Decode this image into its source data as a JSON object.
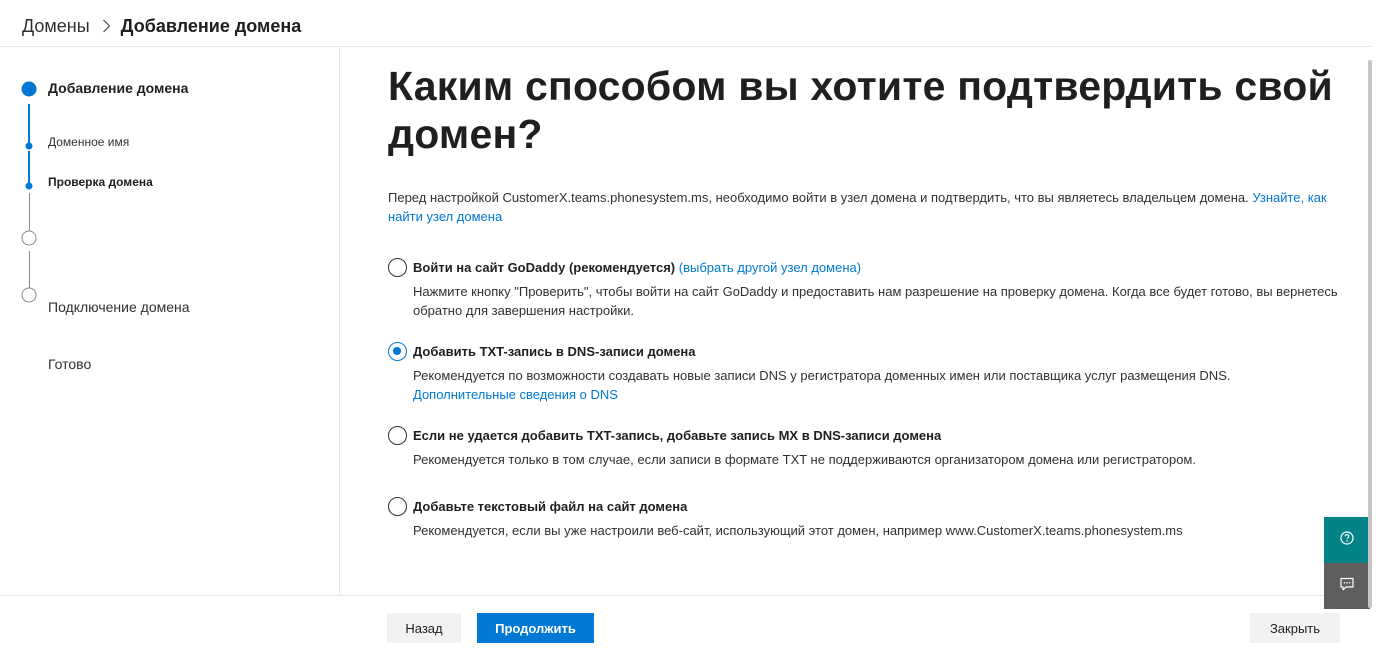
{
  "breadcrumb": {
    "root": "Домены",
    "current": "Добавление домена"
  },
  "stepper": {
    "steps": [
      {
        "label": "Добавление домена",
        "state": "current"
      },
      {
        "label": "Доменное имя",
        "state": "done"
      },
      {
        "label": "Проверка домена",
        "state": "current"
      },
      {
        "label": "Подключение домена",
        "state": "pending"
      },
      {
        "label": "Готово",
        "state": "pending"
      }
    ]
  },
  "main": {
    "title": "Каким способом вы хотите подтвердить свой домен?",
    "intro_text": "Перед настройкой CustomerX.teams.phonesystem.ms, необходимо войти в узел домена и подтвердить, что вы являетесь владельцем домена. ",
    "intro_link": "Узнайте, как найти узел домена",
    "options": [
      {
        "title": "Войти на сайт GoDaddy (рекомендуется)",
        "title_link": "(выбрать другой узел домена)",
        "desc": "Нажмите кнопку \"Проверить\", чтобы войти на сайт GoDaddy и предоставить нам разрешение на проверку домена. Когда все будет готово, вы вернетесь обратно для завершения настройки.",
        "selected": false
      },
      {
        "title": "Добавить TXT-запись в DNS-записи домена",
        "desc": "Рекомендуется по возможности создавать новые записи DNS у регистратора доменных имен или поставщика услуг размещения DNS.",
        "desc_link": "Дополнительные сведения о DNS",
        "selected": true
      },
      {
        "title": "Если не удается добавить TXT-запись, добавьте запись MX в DNS-записи домена",
        "desc": "Рекомендуется только в том случае, если записи в формате TXT не поддерживаются организатором домена или регистратором.",
        "selected": false
      },
      {
        "title": "Добавьте текстовый файл на сайт домена",
        "desc": "Рекомендуется, если вы уже настроили веб-сайт, использующий этот домен, например www.CustomerX.teams.phonesystem.ms",
        "selected": false
      }
    ]
  },
  "footer": {
    "back_label": "Назад",
    "continue_label": "Продолжить",
    "close_label": "Закрыть"
  },
  "colors": {
    "accent": "#0078d4",
    "help_fab": "#038387",
    "feedback_fab": "#605e5c"
  },
  "icons": {
    "breadcrumb_separator": "chevron-right-icon",
    "help": "help-circle-icon",
    "feedback": "feedback-icon"
  }
}
